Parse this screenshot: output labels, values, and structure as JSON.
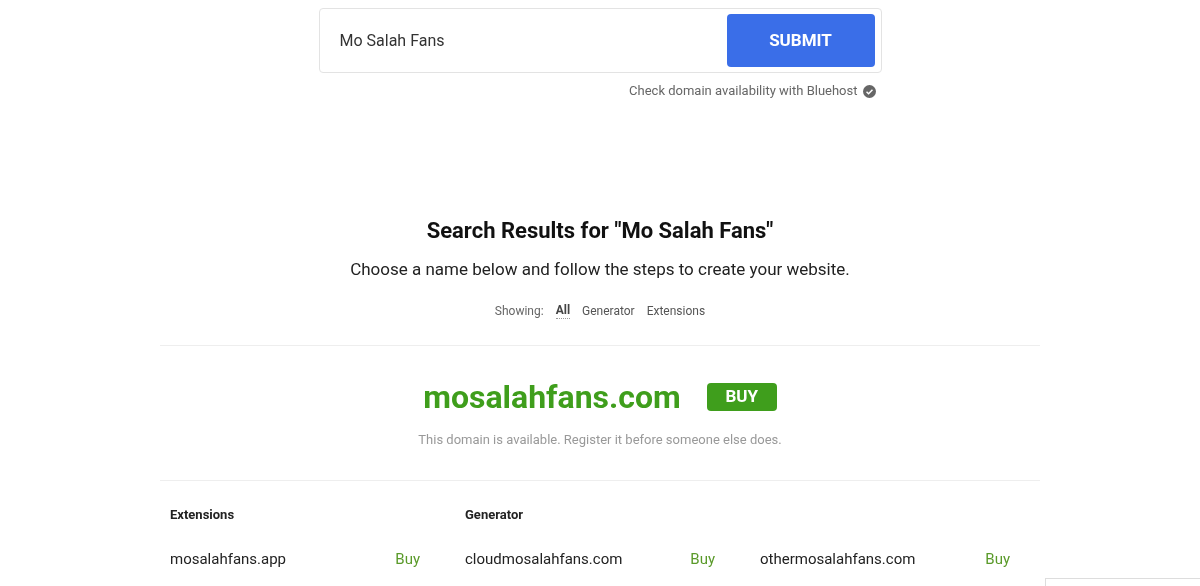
{
  "search": {
    "value": "Mo Salah Fans",
    "submit": "SUBMIT",
    "note": "Check domain availability with Bluehost"
  },
  "results": {
    "title": "Search Results for \"Mo Salah Fans\"",
    "subtitle": "Choose a name below and follow the steps to create your website.",
    "filter_label": "Showing:",
    "filters": [
      {
        "label": "All",
        "selected": true
      },
      {
        "label": "Generator",
        "selected": false
      },
      {
        "label": "Extensions",
        "selected": false
      }
    ]
  },
  "featured": {
    "domain": "mosalahfans.com",
    "buy": "BUY",
    "message": "This domain is available. Register it before someone else does."
  },
  "groups": [
    {
      "heading": "Extensions",
      "columns": [
        [
          {
            "domain": "mosalahfans.app",
            "buy": "Buy"
          }
        ]
      ]
    },
    {
      "heading": "Generator",
      "columns": [
        [
          {
            "domain": "cloudmosalahfans.com",
            "buy": "Buy"
          }
        ],
        [
          {
            "domain": "othermosalahfans.com",
            "buy": "Buy"
          }
        ]
      ]
    }
  ]
}
